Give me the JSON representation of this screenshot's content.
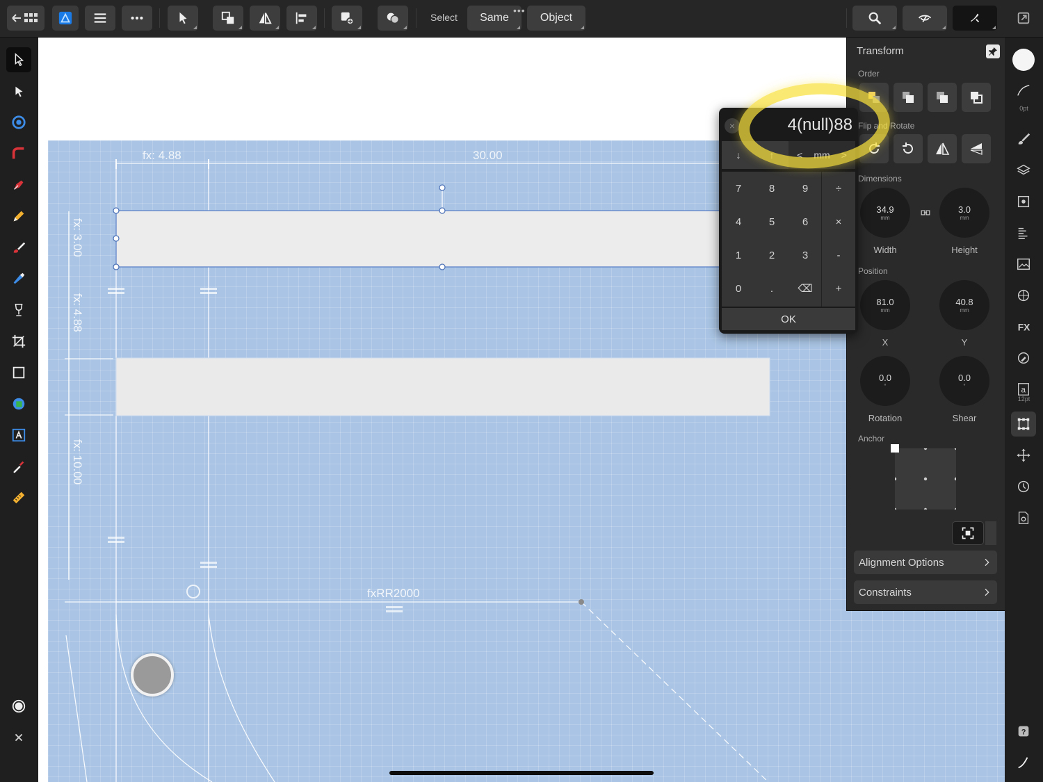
{
  "toolbar": {
    "select_label": "Select",
    "same_label": "Same",
    "object_label": "Object"
  },
  "canvas": {
    "dimensions": {
      "top_left": "fx: 4.88",
      "top_right": "30.00",
      "left_1": "fx: 3.00",
      "left_2": "fx: 4.88",
      "left_3": "fx: 10.00",
      "bottom": "fxRR2000"
    }
  },
  "calculator": {
    "display": "4(null)88",
    "units": {
      "down": "↓",
      "up": "↑",
      "prev": "<",
      "unit": "mm",
      "next": ">"
    },
    "keys": [
      "7",
      "8",
      "9",
      "÷",
      "4",
      "5",
      "6",
      "×",
      "1",
      "2",
      "3",
      "-",
      "0",
      ".",
      "⌫",
      "+"
    ],
    "ok_label": "OK"
  },
  "transform": {
    "title": "Transform",
    "order_label": "Order",
    "flip_rotate_label": "Flip and Rotate",
    "dimensions_label": "Dimensions",
    "width": {
      "value": "34.9",
      "unit": "mm",
      "label": "Width"
    },
    "height": {
      "value": "3.0",
      "unit": "mm",
      "label": "Height"
    },
    "position_label": "Position",
    "x": {
      "value": "81.0",
      "unit": "mm",
      "label": "X"
    },
    "y": {
      "value": "40.8",
      "unit": "mm",
      "label": "Y"
    },
    "rotation": {
      "value": "0.0",
      "unit": "°",
      "label": "Rotation"
    },
    "shear": {
      "value": "0.0",
      "unit": "°",
      "label": "Shear"
    },
    "anchor_label": "Anchor",
    "alignment_options": "Alignment Options",
    "constraints": "Constraints"
  },
  "right_strip": {
    "stroke_width": "0pt",
    "text_size": "12pt"
  },
  "colors": {
    "accent": "#0a84ff",
    "highlight": "#f8e13c",
    "artboard": "#a9c4e4",
    "panel": "#2a2a2a"
  }
}
